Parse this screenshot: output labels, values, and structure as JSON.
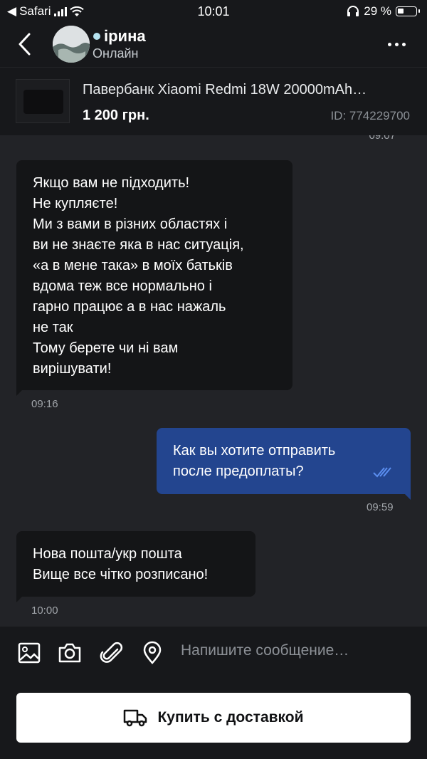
{
  "status_bar": {
    "back_app": "Safari",
    "time": "10:01",
    "battery": "29 %"
  },
  "header": {
    "name": "ірина",
    "status": "Онлайн"
  },
  "product": {
    "title": "Павербанк Xiaomi Redmi 18W 20000mAh…",
    "price": "1 200 грн.",
    "id": "ID: 774229700"
  },
  "chat": {
    "cut_time": "09:07",
    "messages": [
      {
        "direction": "in",
        "time": "09:16",
        "lines": [
          "Якщо вам не підходить!",
          "Не купляєте!",
          "Ми з вами в різних областях і",
          "ви не знаєте яка в нас ситуація,",
          "«а в мене така» в моїх батьків",
          "вдома теж все нормально і",
          "гарно працює а в нас нажаль",
          "не так",
          "Тому берете чи ні вам",
          "вирішувати!"
        ]
      },
      {
        "direction": "out",
        "time": "09:59",
        "lines": [
          "Как вы хотите отправить",
          "после предоплаты?"
        ]
      },
      {
        "direction": "in",
        "time": "10:00",
        "lines": [
          "Нова пошта/укр пошта",
          "Вище все чітко розписано!"
        ]
      }
    ]
  },
  "composer": {
    "placeholder": "Напишите сообщение…",
    "buy_label": "Купить с доставкой"
  },
  "colors": {
    "background": "#222327",
    "bar": "#17181b",
    "incoming": "#141517",
    "outgoing": "#23458f",
    "read_check": "#5b8ef0"
  }
}
